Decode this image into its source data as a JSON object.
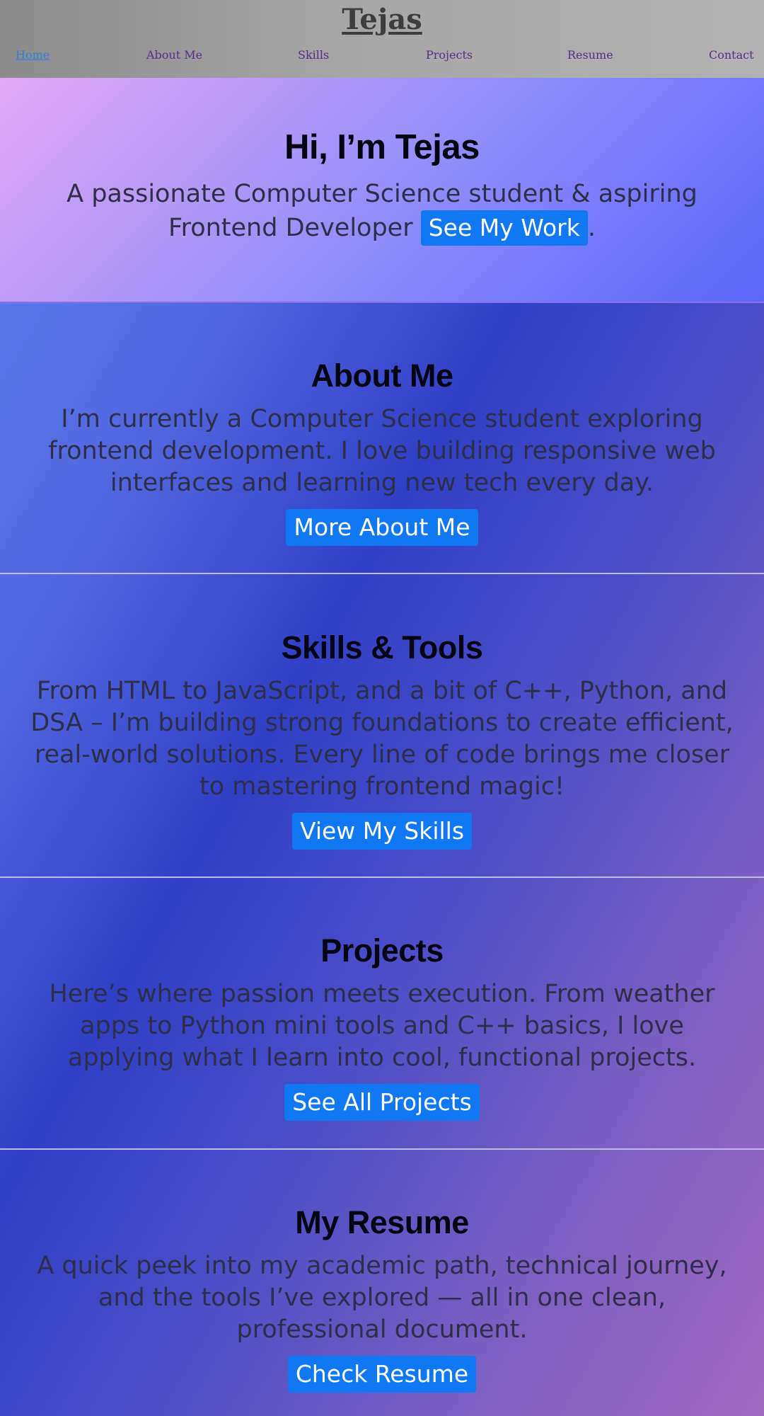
{
  "header": {
    "brand": "Tejas",
    "nav": [
      "Home",
      "About Me",
      "Skills",
      "Projects",
      "Resume",
      "Contact"
    ],
    "active_nav": "Home"
  },
  "hero": {
    "title": "Hi, I’m Tejas",
    "text_before": "A passionate Computer Science student & aspiring Frontend Developer",
    "button": "See My Work",
    "text_after": "."
  },
  "about": {
    "title": "About Me",
    "text": "I’m currently a Computer Science student exploring frontend development. I love building responsive web interfaces and learning new tech every day.",
    "button": "More About Me"
  },
  "skills": {
    "title": "Skills & Tools",
    "text": "From HTML to JavaScript, and a bit of C++, Python, and DSA – I’m building strong foundations to create efficient, real-world solutions. Every line of code brings me closer to mastering frontend magic!",
    "button": "View My Skills"
  },
  "projects": {
    "title": "Projects",
    "text": "Here’s where passion meets execution. From weather apps to Python mini tools and C++ basics, I love applying what I learn into cool, functional projects.",
    "button": "See All Projects"
  },
  "resume": {
    "title": "My Resume",
    "text": "A quick peek into my academic path, technical journey, and the tools I’ve explored — all in one clean, professional document.",
    "button": "Check Resume"
  },
  "colors": {
    "button": "#0f78f2",
    "nav_link": "#5b2b8a",
    "nav_active": "#2f7de0"
  }
}
